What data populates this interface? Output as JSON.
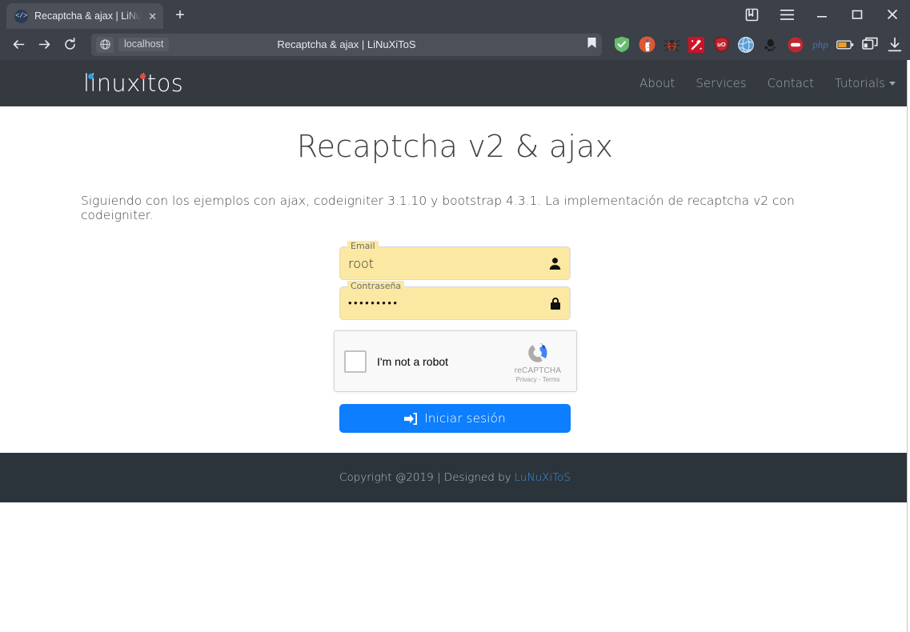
{
  "browser": {
    "tab": {
      "favicon": "code-favicon",
      "favicon_glyph": "</>",
      "title": "Recaptcha & ajax | LiNuX",
      "close_glyph": "✕"
    },
    "newtab_glyph": "+",
    "window_controls": {
      "bookmarks_label": "bookmarks-sidebar",
      "menu_label": "application-menu",
      "minimize_glyph": "–",
      "maximize_glyph": "□",
      "close_glyph": "✕"
    },
    "toolbar": {
      "back_glyph": "←",
      "forward_glyph": "→",
      "reload_glyph": "⟳",
      "url_host": "localhost",
      "url_page_title": "Recaptcha & ajax | LiNuXiToS",
      "bookmark_label": "bookmark-star"
    },
    "extensions": [
      {
        "name": "adguard-icon"
      },
      {
        "name": "duckduckgo-privacy-icon"
      },
      {
        "name": "debug-bug-icon"
      },
      {
        "name": "wand-magic-icon"
      },
      {
        "name": "ublock-origin-icon"
      },
      {
        "name": "globe-blue-icon"
      },
      {
        "name": "gnome-foot-icon"
      },
      {
        "name": "stop-circle-icon"
      },
      {
        "name": "php-icon",
        "label": "php"
      },
      {
        "name": "battery-icon"
      },
      {
        "name": "tab-manager-icon"
      },
      {
        "name": "downloads-icon"
      }
    ]
  },
  "site": {
    "brand": "linuxitos",
    "brand_colors": {
      "dot_blue": "#2f9fe0",
      "dot_red": "#e8493a",
      "navbar_bg": "#343a40"
    },
    "nav": [
      {
        "label": "About",
        "has_caret": false
      },
      {
        "label": "Services",
        "has_caret": false
      },
      {
        "label": "Contact",
        "has_caret": false
      },
      {
        "label": "Tutorials",
        "has_caret": true
      }
    ],
    "page_title": "Recaptcha v2 & ajax",
    "page_description": "Siguiendo con los ejemplos con ajax, codeigniter 3.1.10 y bootstrap 4.3.1. La implementación de recaptcha v2 con codeigniter.",
    "form": {
      "email": {
        "label": "Email",
        "value": "root",
        "placeholder": "Email",
        "icon": "user-icon"
      },
      "password": {
        "label": "Contraseña",
        "value": "•••••••••",
        "placeholder": "Contraseña",
        "icon": "lock-icon"
      },
      "recaptcha": {
        "checkbox_label": "I'm not a robot",
        "brand": "reCAPTCHA",
        "terms": "Privacy - Terms",
        "logo": "recaptcha-logo-icon",
        "checked": false
      },
      "submit": {
        "label": "Iniciar sesión",
        "icon": "sign-in-icon",
        "color": "#0d7efd"
      }
    },
    "footer": {
      "text": "Copyright @2019 | Designed by",
      "link": "LuNuXiToS",
      "link_color": "#3f8ee0",
      "bg": "#2b343b"
    }
  }
}
